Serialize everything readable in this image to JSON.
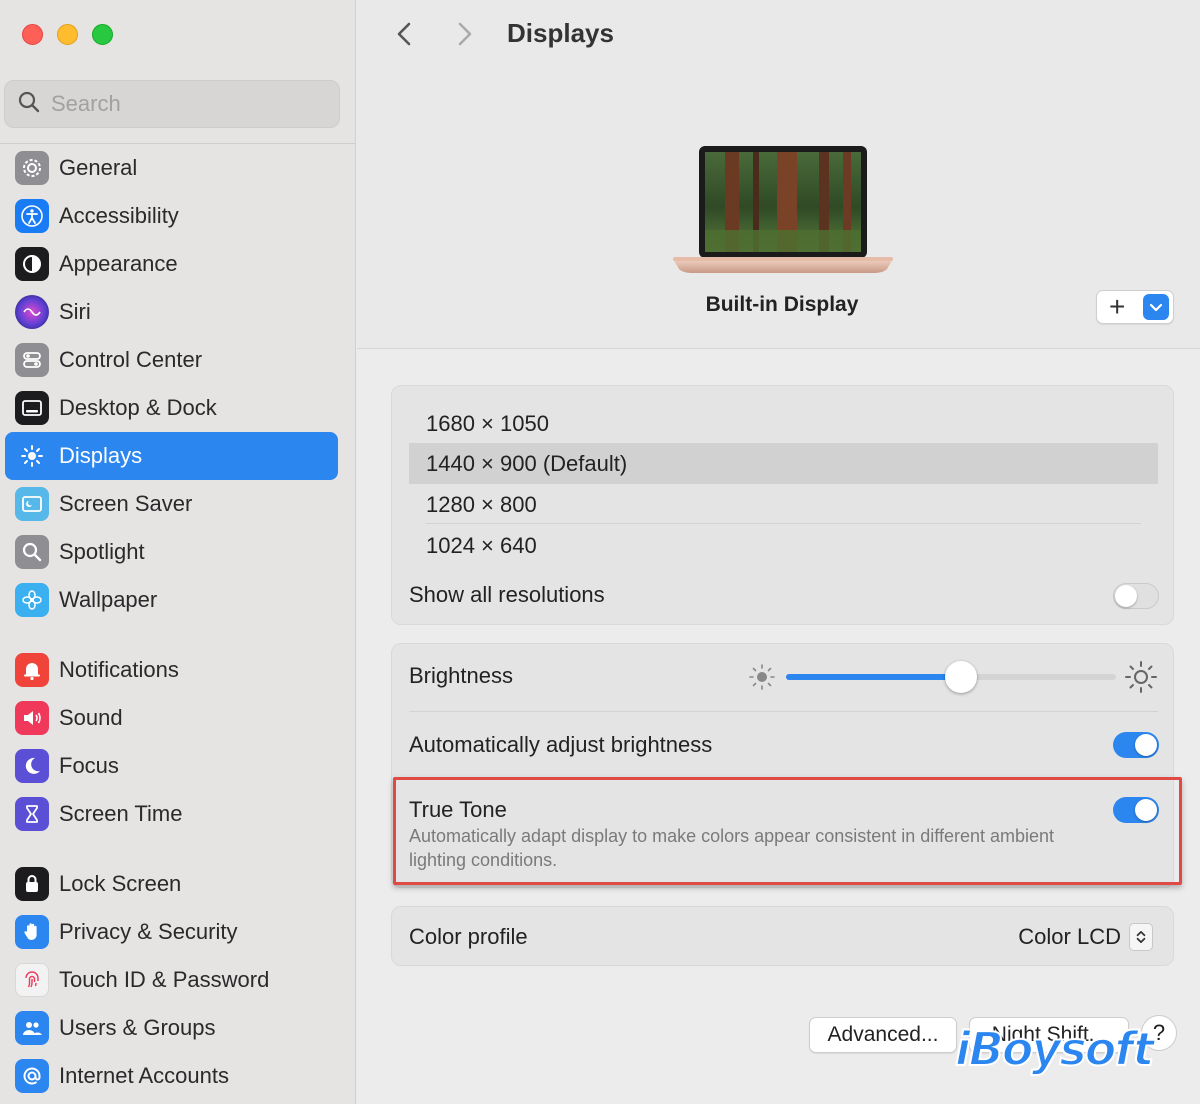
{
  "window": {
    "title": "Displays"
  },
  "search": {
    "placeholder": "Search"
  },
  "sidebar": {
    "groups": [
      [
        {
          "label": "General",
          "icon": "gear-icon",
          "color": "#8e8e93"
        },
        {
          "label": "Accessibility",
          "icon": "accessibility-icon",
          "color": "#1a7cf5"
        },
        {
          "label": "Appearance",
          "icon": "appearance-icon",
          "color": "#1c1c1e"
        },
        {
          "label": "Siri",
          "icon": "siri-icon",
          "color": "#6b3fd4"
        },
        {
          "label": "Control Center",
          "icon": "control-center-icon",
          "color": "#8e8e93"
        },
        {
          "label": "Desktop & Dock",
          "icon": "dock-icon",
          "color": "#1c1c1e"
        },
        {
          "label": "Displays",
          "icon": "sun-icon",
          "color": "#2b86ef",
          "active": true
        },
        {
          "label": "Screen Saver",
          "icon": "screen-saver-icon",
          "color": "#56b8e8"
        },
        {
          "label": "Spotlight",
          "icon": "magnifier-icon",
          "color": "#8e8e93"
        },
        {
          "label": "Wallpaper",
          "icon": "flower-icon",
          "color": "#3ab0f0"
        }
      ],
      [
        {
          "label": "Notifications",
          "icon": "bell-icon",
          "color": "#f0443a"
        },
        {
          "label": "Sound",
          "icon": "speaker-icon",
          "color": "#f0385b"
        },
        {
          "label": "Focus",
          "icon": "moon-icon",
          "color": "#5b4fd6"
        },
        {
          "label": "Screen Time",
          "icon": "hourglass-icon",
          "color": "#5b4fd6"
        }
      ],
      [
        {
          "label": "Lock Screen",
          "icon": "lock-icon",
          "color": "#1c1c1e"
        },
        {
          "label": "Privacy & Security",
          "icon": "hand-icon",
          "color": "#2b86ef"
        },
        {
          "label": "Touch ID & Password",
          "icon": "fingerprint-icon",
          "color": "#f2f2f2"
        },
        {
          "label": "Users & Groups",
          "icon": "users-icon",
          "color": "#2b86ef"
        },
        {
          "label": "Internet Accounts",
          "icon": "at-icon",
          "color": "#2b86ef"
        }
      ]
    ]
  },
  "header": {
    "title": "Displays",
    "display_name": "Built-in Display",
    "add_symbol": "+"
  },
  "resolutions": {
    "items": [
      "1680 × 1050",
      "1440 × 900 (Default)",
      "1280 × 800",
      "1024 × 640"
    ],
    "selected_index": 1,
    "show_all_label": "Show all resolutions",
    "show_all_on": false
  },
  "brightness": {
    "label": "Brightness",
    "level": 0.53,
    "auto_label": "Automatically adjust brightness",
    "auto_on": true
  },
  "true_tone": {
    "label": "True Tone",
    "description": "Automatically adapt display to make colors appear consistent in different ambient lighting conditions.",
    "on": true
  },
  "color_profile": {
    "label": "Color profile",
    "value": "Color LCD"
  },
  "footer": {
    "advanced_label": "Advanced...",
    "night_shift_label": "Night Shift...",
    "help_label": "?"
  },
  "watermark": {
    "text": "iBoysoft"
  },
  "colors": {
    "accent": "#2b86ef",
    "highlight_border": "#e04a45"
  }
}
